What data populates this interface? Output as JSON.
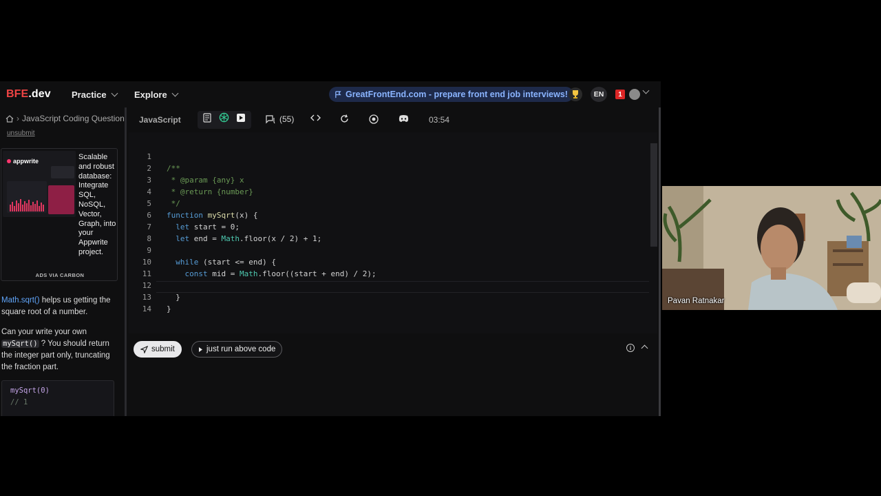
{
  "nav": {
    "logo_main": "BFE",
    "logo_suffix": ".dev",
    "practice": "Practice",
    "explore": "Explore",
    "promo": "GreatFrontEnd.com - prepare front end job interviews!",
    "lang": "EN",
    "notifications": "1"
  },
  "left": {
    "breadcrumb": "JavaScript Coding Questions",
    "unsubmit": "unsubmit",
    "ad": {
      "brand": "appwrite",
      "text": "Scalable and robust database: Integrate SQL, NoSQL, Vector, Graph, into your Appwrite project.",
      "via": "ADS VIA CARBON"
    },
    "desc1_link": "Math.sqrt()",
    "desc1_rest": " helps us getting the square root of a number.",
    "desc2_pre": "Can your write your own ",
    "desc2_code": "mySqrt()",
    "desc2_post": " ? You should return the integer part only, truncating the fraction part.",
    "example_line1": "mySqrt(0)",
    "example_line2": "// 1"
  },
  "toolbar": {
    "language": "JavaScript",
    "comments_count": "(55)",
    "timer": "03:54"
  },
  "code": {
    "line_numbers": [
      "1",
      "2",
      "3",
      "4",
      "5",
      "6",
      "7",
      "8",
      "9",
      "10",
      "11",
      "12",
      "13",
      "14"
    ]
  },
  "actions": {
    "submit": "submit",
    "run": "just run above code"
  },
  "video": {
    "participant": "Pavan Ratnakar"
  },
  "colors": {
    "accent_red": "#ef4444",
    "promo_blue": "#8ab4ff",
    "comment_green": "#6a9955",
    "keyword_blue": "#569cd6"
  }
}
